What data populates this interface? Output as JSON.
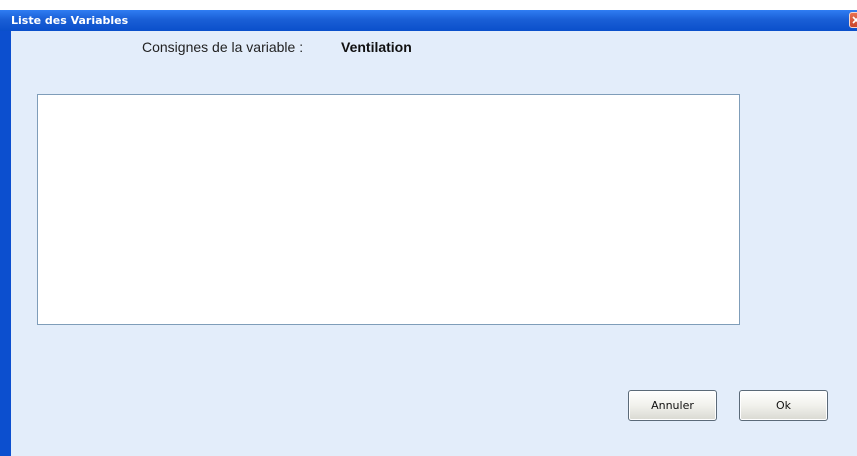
{
  "window": {
    "title": "Liste des Variables",
    "close_icon": "close-icon"
  },
  "prompt": {
    "label": "Consignes de la variable :",
    "variable_name": "Ventilation"
  },
  "textarea": {
    "value": ""
  },
  "buttons": {
    "cancel_label": "Annuler",
    "ok_label": "Ok"
  },
  "colors": {
    "titlebar": "#0a4fcb",
    "client_background": "#e3edfa",
    "close_button": "#c9452b"
  }
}
